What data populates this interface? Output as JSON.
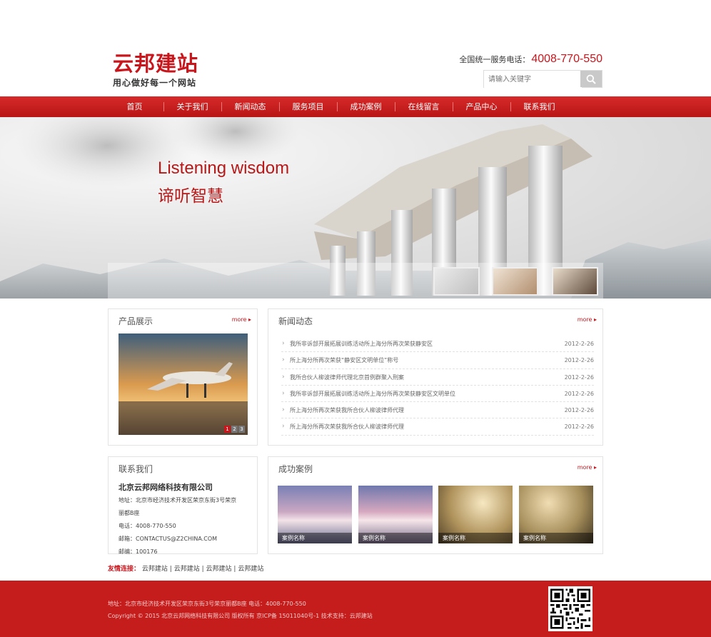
{
  "header": {
    "logo_title": "云邦建站",
    "logo_slogan": "用心做好每一个网站",
    "hotline_label": "全国统一服务电话：",
    "hotline_number": "4008-770-550",
    "search_placeholder": "请输入关键字",
    "search_icon": "search-icon"
  },
  "nav": {
    "items": [
      "首页",
      "关于我们",
      "新闻动态",
      "服务项目",
      "成功案例",
      "在线留言",
      "产品中心",
      "联系我们"
    ]
  },
  "banner": {
    "title_en": "Listening wisdom",
    "title_cn": "谛听智慧"
  },
  "products": {
    "title": "产品展示",
    "more": "more",
    "pages": [
      "1",
      "2",
      "3"
    ],
    "current_page": 1
  },
  "news": {
    "title": "新闻动态",
    "more": "more",
    "items": [
      {
        "title": "我所非诉部开展拓展训练活动所上海分所再次荣获静安区",
        "date": "2012-2-26"
      },
      {
        "title": "所上海分所再次荣获“静安区文明单位”称号",
        "date": "2012-2-26"
      },
      {
        "title": "我所合伙人柳波律师代理北京首例群聚入刑案",
        "date": "2012-2-26"
      },
      {
        "title": "我所非诉部开展拓展训练活动所上海分所再次荣获静安区文明单位",
        "date": "2012-2-26"
      },
      {
        "title": "所上海分所再次荣获我所合伙人柳波律师代理",
        "date": "2012-2-26"
      },
      {
        "title": "所上海分所再次荣获我所合伙人柳波律师代理",
        "date": "2012-2-26"
      }
    ]
  },
  "contact": {
    "title": "联系我们",
    "company": "北京云邦网络科技有限公司",
    "address_1": "地址：北京市经济技术开发区荣京东街3号荣京",
    "address_2": "丽都B座",
    "phone": "电话：4008-770-550",
    "email": "邮箱：CONTACTUS@Z2CHINA.COM",
    "postcode": "邮编：100176"
  },
  "cases": {
    "title": "成功案例",
    "more": "more",
    "items": [
      "案例名称",
      "案例名称",
      "案例名称",
      "案例名称"
    ]
  },
  "friend_links": {
    "label": "友情连接：",
    "items": [
      "云邦建站",
      "云邦建站",
      "云邦建站",
      "云邦建站"
    ],
    "separator": "|"
  },
  "footer": {
    "line1": "地址：北京市经济技术开发区荣京东街3号荣京丽都B座 电话：4008-770-550",
    "line2": "Copyright © 2015 北京云邦网络科技有限公司 版权所有 京ICP备 15011040号-1   技术支持：云邦建站"
  },
  "colors": {
    "brand_red": "#c8161d",
    "nav_red": "#c51c1c"
  }
}
